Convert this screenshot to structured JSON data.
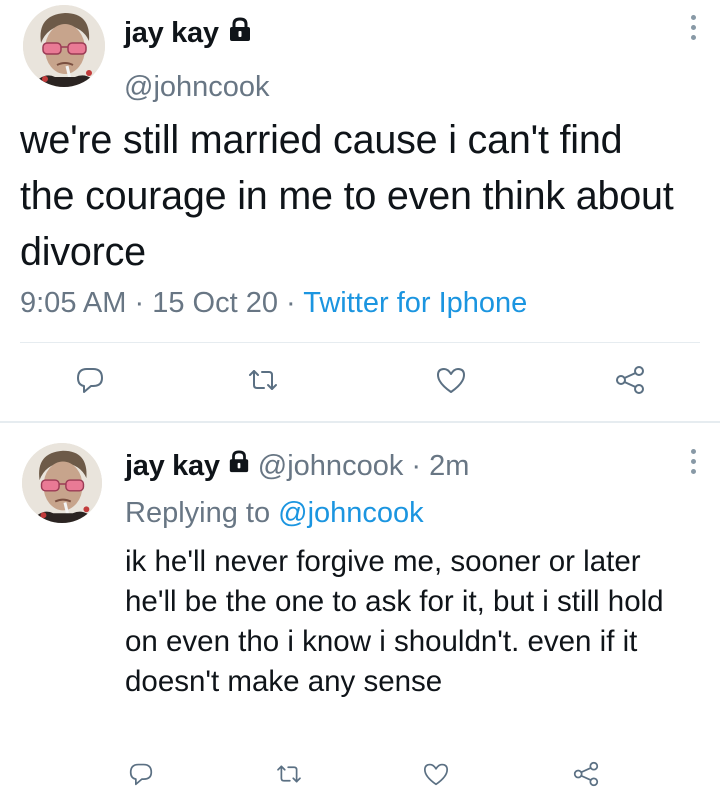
{
  "main_tweet": {
    "display_name": "jay kay",
    "handle": "@johncook",
    "text": "we're still married cause i can't find the courage in me to even think about divorce",
    "time": "9:05 AM",
    "date": "15 Oct 20",
    "source": "Twitter for Iphone",
    "separator": "·"
  },
  "reply": {
    "display_name": "jay kay",
    "handle": "@johncook",
    "separator": "·",
    "age": "2m",
    "replying_prefix": "Replying to",
    "replying_to": "@johncook",
    "text": "ik he'll never forgive me, sooner or later he'll be the one to ask for it, but i still hold on even tho i know i shouldn't. even if it doesn't make any sense"
  },
  "icons": {
    "protected": "lock-icon",
    "more": "more-vertical-icon",
    "reply": "reply-icon",
    "retweet": "retweet-icon",
    "like": "heart-icon",
    "share": "share-icon"
  },
  "colors": {
    "text": "#0f1419",
    "muted": "#687684",
    "link": "#1b95e0",
    "icon": "#5b7083",
    "divider": "#e6ecf0"
  }
}
